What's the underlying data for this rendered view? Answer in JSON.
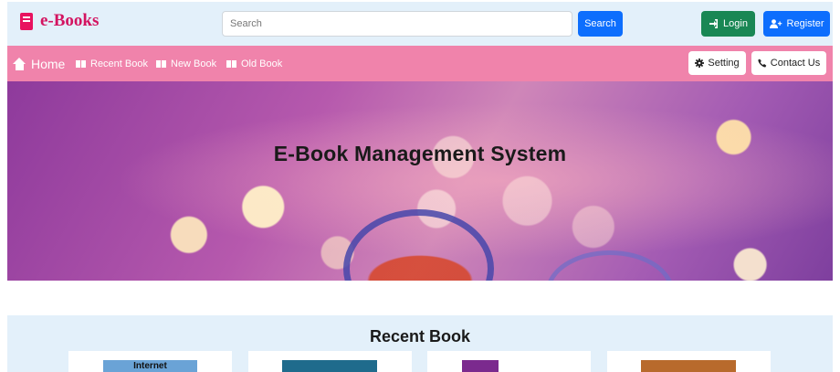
{
  "header": {
    "logo_text": "e-Books",
    "search_placeholder": "Search",
    "search_label": "Search",
    "login_label": "Login",
    "register_label": "Register"
  },
  "nav": {
    "home": "Home",
    "recent_book": "Recent Book",
    "new_book": "New Book",
    "old_book": "Old Book",
    "setting": "Setting",
    "contact_us": "Contact Us"
  },
  "hero": {
    "title": "E-Book Management System"
  },
  "recent": {
    "title": "Recent Book",
    "cards": [
      {
        "cover_text": "Internet"
      },
      {
        "cover_text": ""
      },
      {
        "cover_text": ""
      },
      {
        "cover_text": ""
      }
    ]
  },
  "colors": {
    "brand": "#d31460",
    "nav_bg": "#f083ab",
    "header_bg": "#e3f0fa",
    "primary": "#0d6efd",
    "success": "#198754"
  }
}
